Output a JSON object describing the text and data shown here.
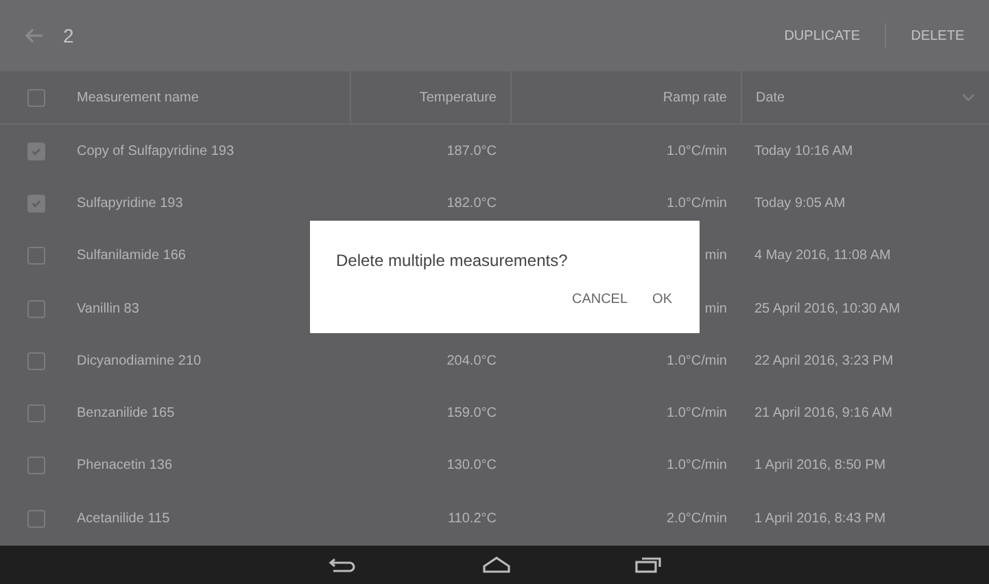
{
  "top_bar": {
    "selected_count": "2",
    "actions": [
      "DUPLICATE",
      "DELETE"
    ]
  },
  "table": {
    "header_checked": false,
    "columns": [
      "Measurement name",
      "Temperature",
      "Ramp rate",
      "Date"
    ],
    "rows": [
      {
        "checked": true,
        "name": "Copy of Sulfapyridine 193",
        "temperature": "187.0°C",
        "ramp_rate": "1.0°C/min",
        "date": "Today 10:16 AM"
      },
      {
        "checked": true,
        "name": "Sulfapyridine 193",
        "temperature": "182.0°C",
        "ramp_rate": "1.0°C/min",
        "date": "Today 9:05 AM"
      },
      {
        "checked": false,
        "name": "Sulfanilamide 166",
        "temperature": "",
        "ramp_rate": "min",
        "date": "4 May 2016, 11:08 AM"
      },
      {
        "checked": false,
        "name": "Vanillin 83",
        "temperature": "",
        "ramp_rate": "min",
        "date": "25 April 2016, 10:30 AM"
      },
      {
        "checked": false,
        "name": "Dicyanodiamine 210",
        "temperature": "204.0°C",
        "ramp_rate": "1.0°C/min",
        "date": "22 April 2016, 3:23 PM"
      },
      {
        "checked": false,
        "name": "Benzanilide 165",
        "temperature": "159.0°C",
        "ramp_rate": "1.0°C/min",
        "date": "21 April 2016, 9:16 AM"
      },
      {
        "checked": false,
        "name": "Phenacetin 136",
        "temperature": "130.0°C",
        "ramp_rate": "1.0°C/min",
        "date": "1 April 2016, 8:50 PM"
      },
      {
        "checked": false,
        "name": "Acetanilide 115",
        "temperature": "110.2°C",
        "ramp_rate": "2.0°C/min",
        "date": "1 April 2016, 8:43 PM"
      }
    ]
  },
  "dialog": {
    "message": "Delete multiple measurements?",
    "buttons": [
      "CANCEL",
      "OK"
    ]
  }
}
